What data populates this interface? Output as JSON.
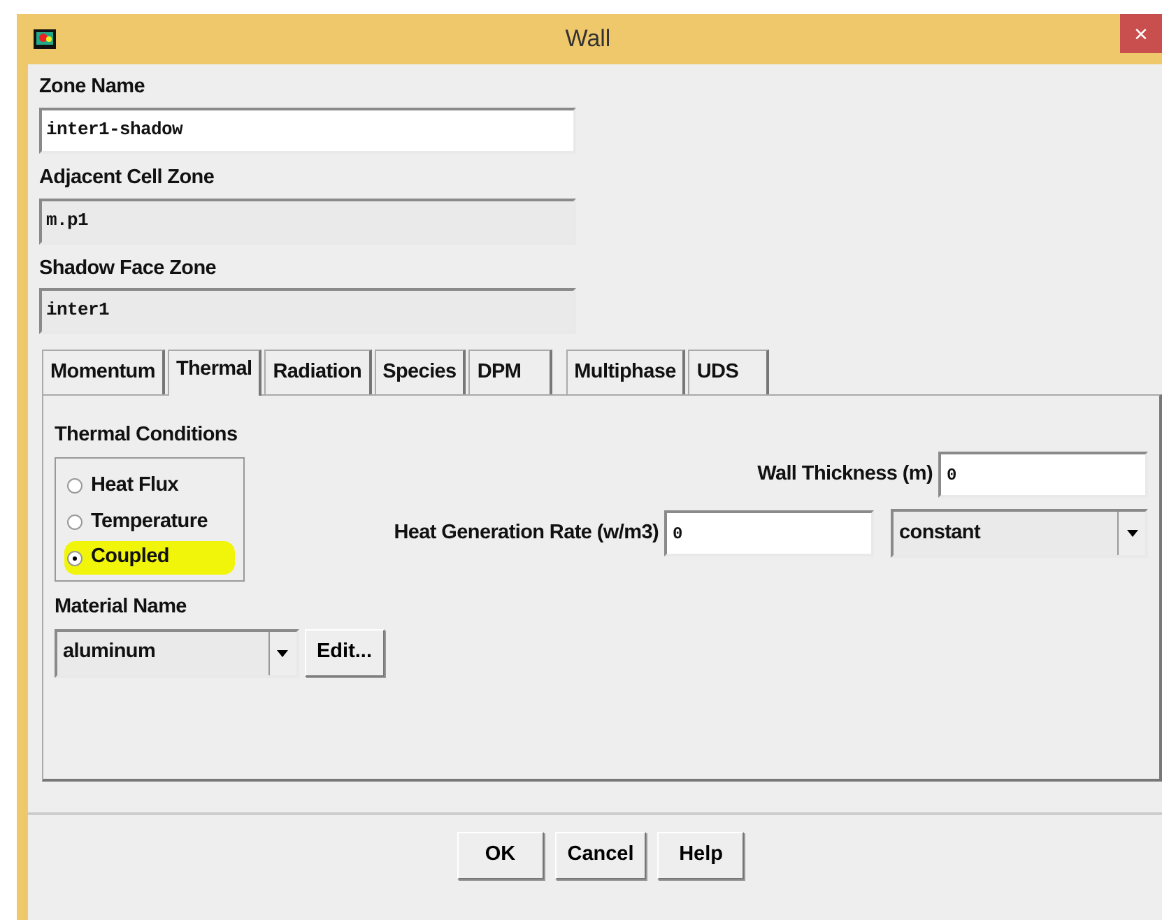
{
  "window": {
    "title": "Wall",
    "close": "×"
  },
  "fields": [
    {
      "label": "Zone Name",
      "value": "inter1-shadow",
      "disabled": false
    },
    {
      "label": "Adjacent Cell Zone",
      "value": "m.p1",
      "disabled": true
    },
    {
      "label": "Shadow Face Zone",
      "value": "inter1",
      "disabled": true
    }
  ],
  "tabs": [
    {
      "label": "Momentum",
      "selected": false
    },
    {
      "label": "Thermal",
      "selected": true
    },
    {
      "label": "Radiation",
      "selected": false
    },
    {
      "label": "Species",
      "selected": false
    },
    {
      "label": "DPM",
      "selected": false
    },
    {
      "label": "Multiphase",
      "selected": false
    },
    {
      "label": "UDS",
      "selected": false
    }
  ],
  "thermal_conditions": {
    "label": "Thermal Conditions",
    "options": [
      {
        "label": "Heat Flux",
        "selected": false,
        "highlighted": false
      },
      {
        "label": "Temperature",
        "selected": false,
        "highlighted": false
      },
      {
        "label": "Coupled",
        "selected": true,
        "highlighted": true
      }
    ]
  },
  "material": {
    "label": "Material Name",
    "value": "aluminum",
    "edit_button": "Edit..."
  },
  "wall_thickness": {
    "label": "Wall Thickness (m)",
    "value": "0"
  },
  "heat_generation": {
    "label": "Heat Generation Rate (w/m3)",
    "value": "0",
    "profile": "constant"
  },
  "buttons": [
    "OK",
    "Cancel",
    "Help"
  ]
}
